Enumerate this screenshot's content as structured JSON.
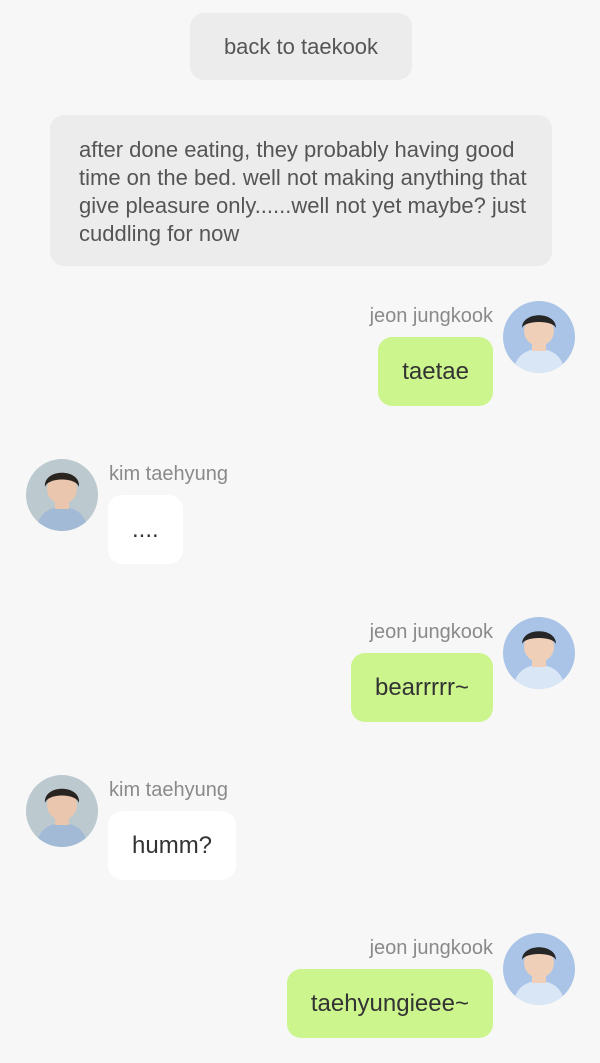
{
  "header": {
    "back_label": "back to taekook"
  },
  "narration": {
    "text": "after done eating, they probably having good time on the bed. well not making anything that give pleasure only......well not yet maybe?  just cuddling for now"
  },
  "colors": {
    "background": "#f7f7f7",
    "neutral_bubble": "#ececec",
    "outgoing_bubble": "#ccf58d",
    "incoming_bubble": "#ffffff",
    "name_text": "#8a8a8a"
  },
  "messages": [
    {
      "sender": "jeon jungkook",
      "side": "right",
      "avatar": "jungkook-avatar",
      "text": "taetae"
    },
    {
      "sender": "kim taehyung",
      "side": "left",
      "avatar": "taehyung-avatar",
      "text": "...."
    },
    {
      "sender": "jeon jungkook",
      "side": "right",
      "avatar": "jungkook-avatar",
      "text": "bearrrrr~"
    },
    {
      "sender": "kim taehyung",
      "side": "left",
      "avatar": "taehyung-avatar",
      "text": "humm?"
    },
    {
      "sender": "jeon jungkook",
      "side": "right",
      "avatar": "jungkook-avatar",
      "text": "taehyungieee~"
    }
  ]
}
